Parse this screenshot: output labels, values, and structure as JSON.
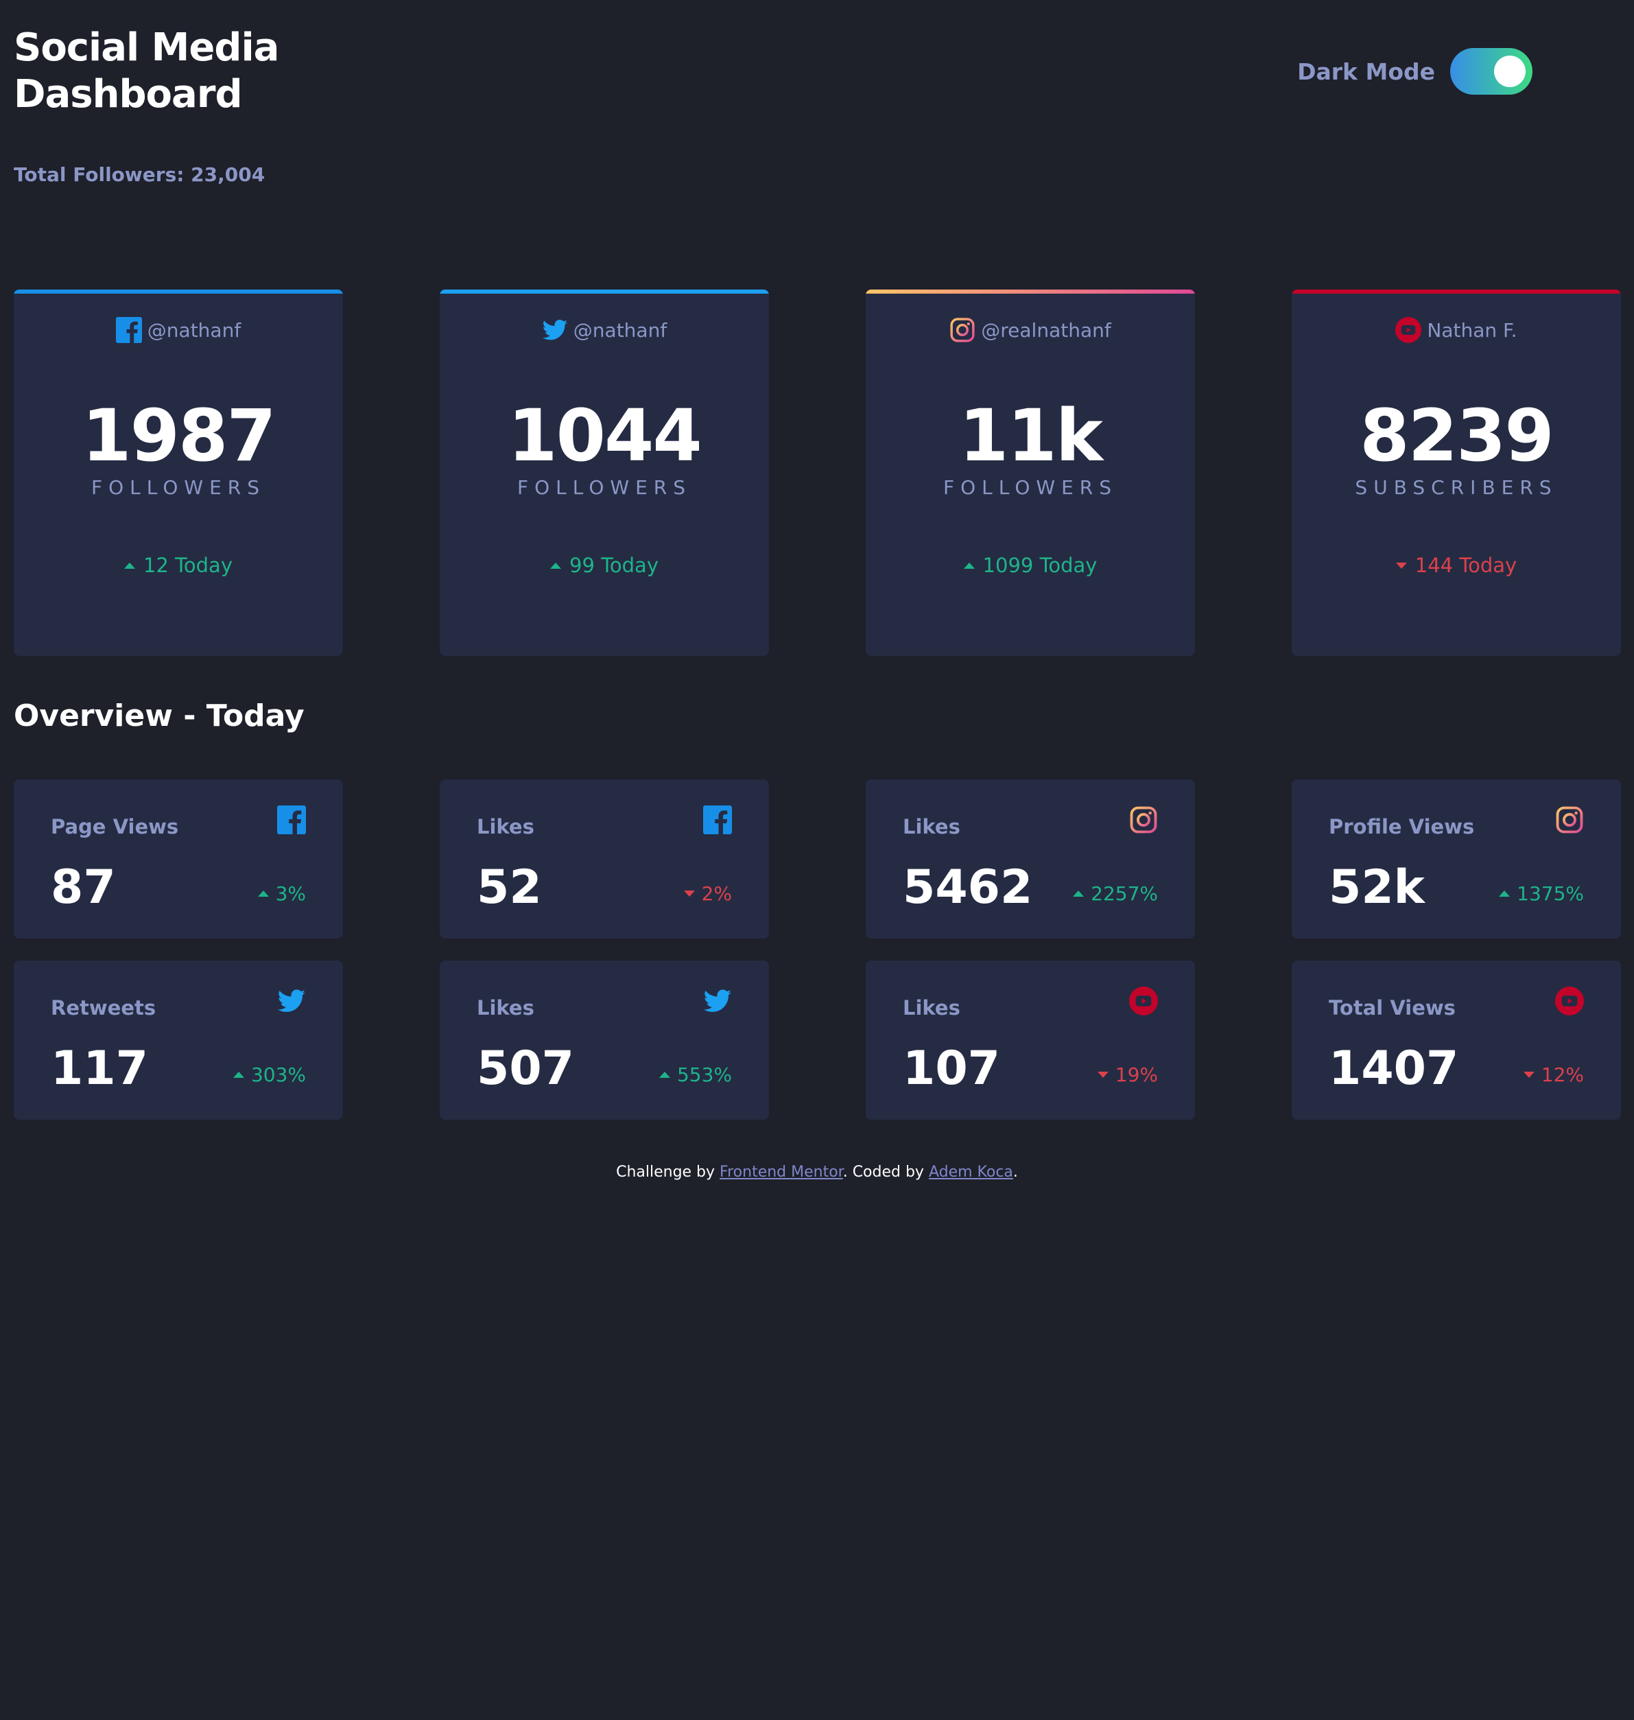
{
  "header": {
    "title": "Social Media Dashboard",
    "total_followers": "Total Followers: 23,004",
    "mode_label": "Dark Mode"
  },
  "colors": {
    "background": "#1e202a",
    "card": "#252b43",
    "muted": "#8b97c6",
    "up": "#1db489",
    "down": "#dc414c",
    "facebook": "#178fe8",
    "twitter": "#1ca0f2",
    "instagram_start": "#fdc468",
    "instagram_end": "#df4996",
    "youtube": "#c4032a"
  },
  "top_cards": [
    {
      "platform": "facebook",
      "icon": "facebook-icon",
      "handle": "@nathanf",
      "count": "1987",
      "unit": "FOLLOWERS",
      "today": "12 Today",
      "trend": "up"
    },
    {
      "platform": "twitter",
      "icon": "twitter-icon",
      "handle": "@nathanf",
      "count": "1044",
      "unit": "FOLLOWERS",
      "today": "99 Today",
      "trend": "up"
    },
    {
      "platform": "instagram",
      "icon": "instagram-icon",
      "handle": "@realnathanf",
      "count": "11k",
      "unit": "FOLLOWERS",
      "today": "1099 Today",
      "trend": "up"
    },
    {
      "platform": "youtube",
      "icon": "youtube-icon",
      "handle": "Nathan F.",
      "count": "8239",
      "unit": "SUBSCRIBERS",
      "today": "144 Today",
      "trend": "down"
    }
  ],
  "overview": {
    "title": "Overview - Today",
    "cards": [
      {
        "label": "Page Views",
        "icon": "facebook-icon",
        "value": "87",
        "pct": "3%",
        "trend": "up"
      },
      {
        "label": "Likes",
        "icon": "facebook-icon",
        "value": "52",
        "pct": "2%",
        "trend": "down"
      },
      {
        "label": "Likes",
        "icon": "instagram-icon",
        "value": "5462",
        "pct": "2257%",
        "trend": "up"
      },
      {
        "label": "Profile Views",
        "icon": "instagram-icon",
        "value": "52k",
        "pct": "1375%",
        "trend": "up"
      },
      {
        "label": "Retweets",
        "icon": "twitter-icon",
        "value": "117",
        "pct": "303%",
        "trend": "up"
      },
      {
        "label": "Likes",
        "icon": "twitter-icon",
        "value": "507",
        "pct": "553%",
        "trend": "up"
      },
      {
        "label": "Likes",
        "icon": "youtube-icon",
        "value": "107",
        "pct": "19%",
        "trend": "down"
      },
      {
        "label": "Total Views",
        "icon": "youtube-icon",
        "value": "1407",
        "pct": "12%",
        "trend": "down"
      }
    ]
  },
  "footer": {
    "prefix": "Challenge by ",
    "link1": "Frontend Mentor",
    "middle": ". Coded by ",
    "link2": "Adem Koca",
    "suffix": "."
  }
}
